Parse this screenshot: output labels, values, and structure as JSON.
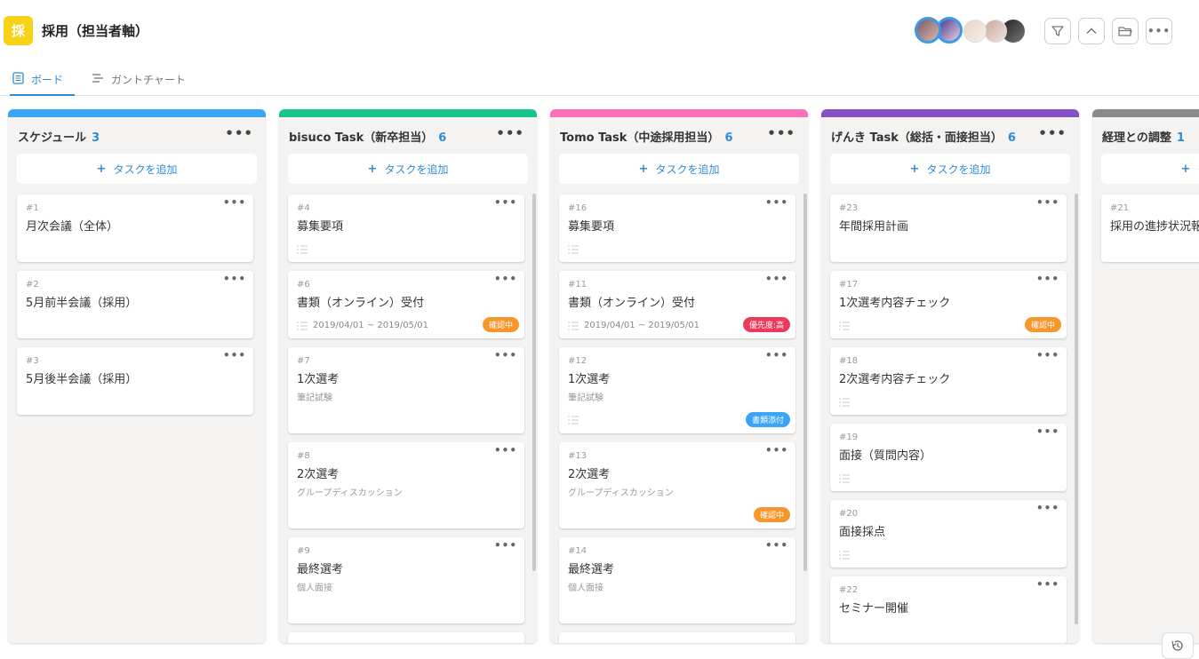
{
  "header": {
    "icon_char": "採",
    "title": "採用（担当者軸）",
    "avatars": [
      "avatar-1",
      "avatar-2",
      "avatar-3",
      "avatar-4",
      "avatar-5"
    ]
  },
  "tabs": [
    {
      "label": "ボード",
      "active": true
    },
    {
      "label": "ガントチャート",
      "active": false
    }
  ],
  "add_label": "タスクを追加",
  "columns": [
    {
      "title": "スケジュール",
      "count": "3",
      "color": "#3aa4f5",
      "cards": [
        {
          "num": "#1",
          "title": "月次会議（全体）"
        },
        {
          "num": "#2",
          "title": "5月前半会議（採用）"
        },
        {
          "num": "#3",
          "title": "5月後半会議（採用）"
        }
      ]
    },
    {
      "title": "bisuco Task（新卒担当）",
      "count": "6",
      "color": "#17c48b",
      "cards": [
        {
          "num": "#4",
          "title": "募集要項"
        },
        {
          "num": "#6",
          "title": "書類（オンライン）受付",
          "date": "2019/04/01 ~ 2019/05/01",
          "badge": "確認中"
        },
        {
          "num": "#7",
          "title": "1次選考",
          "sub": "筆記試験"
        },
        {
          "num": "#8",
          "title": "2次選考",
          "sub": "グループディスカッション"
        },
        {
          "num": "#9",
          "title": "最終選考",
          "sub": "個人面接"
        }
      ]
    },
    {
      "title": "Tomo Task（中途採用担当）",
      "count": "6",
      "color": "#fd6fb7",
      "cards": [
        {
          "num": "#16",
          "title": "募集要項"
        },
        {
          "num": "#11",
          "title": "書類（オンライン）受付",
          "date": "2019/04/01 ~ 2019/05/01",
          "badge": "優先度:高"
        },
        {
          "num": "#12",
          "title": "1次選考",
          "sub": "筆記試験",
          "badge": "書類添付"
        },
        {
          "num": "#13",
          "title": "2次選考",
          "sub": "グループディスカッション",
          "badge": "確認中"
        },
        {
          "num": "#14",
          "title": "最終選考",
          "sub": "個人面接"
        }
      ]
    },
    {
      "title": "げんき Task（総括・面接担当）",
      "count": "6",
      "color": "#8650c8",
      "cards": [
        {
          "num": "#23",
          "title": "年間採用計画"
        },
        {
          "num": "#17",
          "title": "1次選考内容チェック",
          "badge": "確認中"
        },
        {
          "num": "#18",
          "title": "2次選考内容チェック"
        },
        {
          "num": "#19",
          "title": "面接（質問内容）"
        },
        {
          "num": "#20",
          "title": "面接採点"
        },
        {
          "num": "#22",
          "title": "セミナー開催"
        }
      ]
    },
    {
      "title": "経理との調整",
      "count": "1",
      "color": "#8a8a8a",
      "cards": [
        {
          "num": "#21",
          "title": "採用の進捗状況報告"
        }
      ]
    }
  ],
  "badge_colors": {
    "確認中": "#f7962b",
    "優先度:高": "#ec3a5c",
    "書類添付": "#3aa4f5"
  }
}
